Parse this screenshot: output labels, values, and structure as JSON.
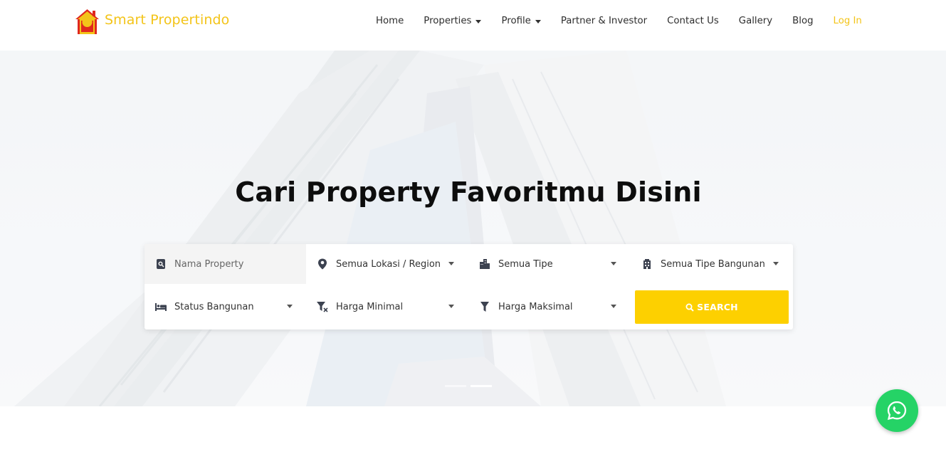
{
  "brand": {
    "name": "Smart Propertindo",
    "logo_icon": "house-logo-icon"
  },
  "nav": {
    "items": [
      {
        "label": "Home",
        "has_dropdown": false
      },
      {
        "label": "Properties",
        "has_dropdown": true
      },
      {
        "label": "Profile",
        "has_dropdown": true
      },
      {
        "label": "Partner & Investor",
        "has_dropdown": false
      },
      {
        "label": "Contact Us",
        "has_dropdown": false
      },
      {
        "label": "Gallery",
        "has_dropdown": false
      },
      {
        "label": "Blog",
        "has_dropdown": false
      }
    ],
    "login_label": "Log In"
  },
  "hero": {
    "title": "Cari Property Favoritmu Disini"
  },
  "search": {
    "name_placeholder": "Nama Property",
    "location": "Semua Lokasi / Region",
    "type": "Semua Tipe",
    "building_type": "Semua Tipe Bangunan",
    "status": "Status Bangunan",
    "min_price": "Harga Minimal",
    "max_price": "Harga Maksimal",
    "button_label": "SEARCH"
  },
  "colors": {
    "brand": "#f3c419",
    "search_button": "#fdd000",
    "whatsapp": "#25d366"
  },
  "slider": {
    "slides": 2,
    "active": 2
  }
}
